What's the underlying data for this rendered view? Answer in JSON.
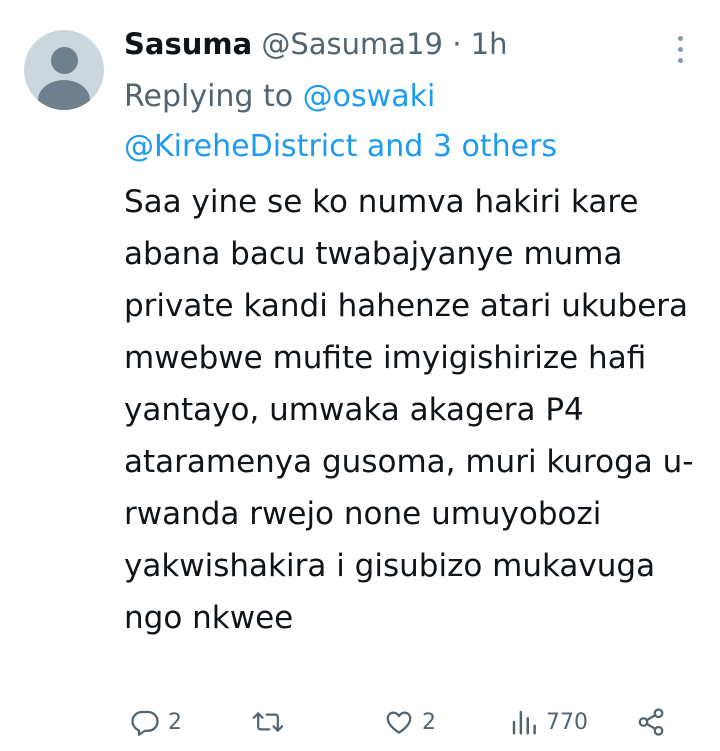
{
  "tweet": {
    "display_name": "Sasuma",
    "handle": "@Sasuma19",
    "separator": "·",
    "time": "1h",
    "replying_prefix": "Replying to ",
    "reply_mention_1": "@oswaki",
    "reply_mention_2": "@KireheDistrict",
    "reply_others": " and 3 others",
    "body": "Saa yine se ko numva hakiri kare abana bacu twabajyanye muma private kandi hahenze atari ukubera mwebwe mufite imyigishirize hafi yantayo, umwaka akagera P4 ataramenya gusoma, muri kuroga u-rwanda rwejo none umuyobozi yakwishakira i gisubizo mukavuga ngo nkwee"
  },
  "actions": {
    "reply_count": "2",
    "retweet_count": "",
    "like_count": "2",
    "views_count": "770"
  },
  "colors": {
    "text": "#0f1419",
    "secondary": "#536471",
    "link": "#1d9bf0",
    "avatar_bg": "#ccd6dd",
    "avatar_fg": "#6e7f8d"
  },
  "icons": {
    "reply": "reply-icon",
    "retweet": "retweet-icon",
    "like": "heart-icon",
    "views": "views-icon",
    "share": "share-icon",
    "more": "more-icon"
  }
}
